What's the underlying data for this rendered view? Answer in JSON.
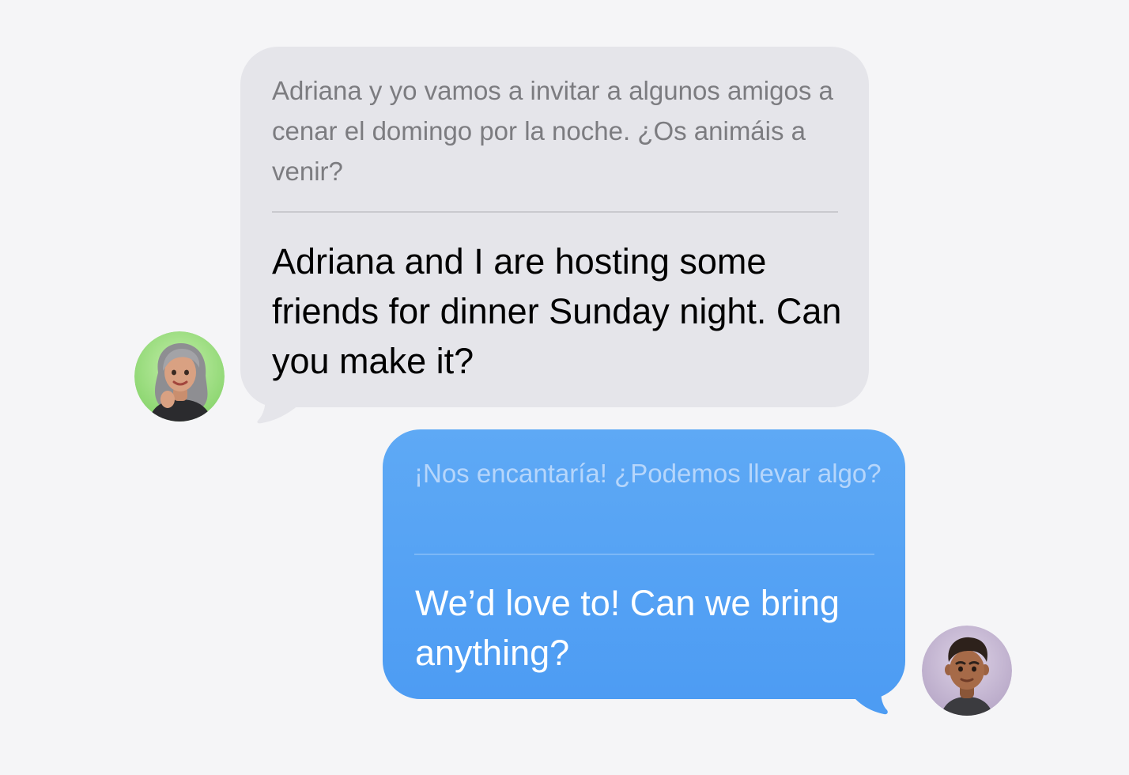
{
  "conversation": {
    "received": {
      "sender_avatar": "memoji-woman-gray-hair",
      "original_text": "Adriana y yo vamos a invitar a algunos amigos a cenar el domingo por la noche. ¿Os animáis a venir?",
      "translated_text": "Adriana and I are hosting some friends for dinner Sunday night. Can you make it?",
      "bubble_color": "#e5e5ea",
      "original_color": "#7c7c80",
      "translated_color": "#000000"
    },
    "sent": {
      "sender_avatar": "memoji-man-dark-hair",
      "original_text": "¡Nos encantaría! ¿Podemos llevar algo?",
      "translated_text": "We’d love to! Can we bring anything?",
      "bubble_color": "#5aa5f4",
      "original_color": "#b6d6fb",
      "translated_color": "#ffffff"
    }
  },
  "colors": {
    "background": "#f5f5f7",
    "avatar_green": "#a8e08f",
    "avatar_purple": "#c9bcd6"
  }
}
